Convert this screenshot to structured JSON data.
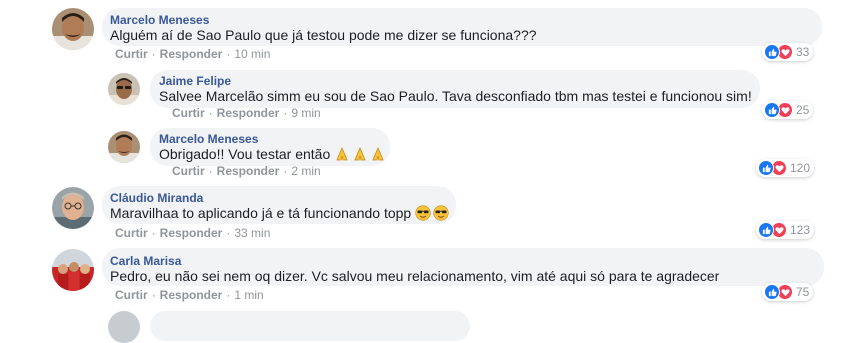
{
  "comments": [
    {
      "author": "Marcelo Meneses",
      "text": "Alguém aí de Sao Paulo que já testou pode me dizer se funciona???",
      "like_label": "Curtir",
      "reply_label": "Responder",
      "time": "10 min",
      "reaction_count": "33",
      "avatar_icon": "man-avatar-icon"
    },
    {
      "author": "Jaime Felipe",
      "text": "Salvee Marcelão simm eu sou de Sao Paulo. Tava desconfiado tbm mas testei e funcionou sim!",
      "like_label": "Curtir",
      "reply_label": "Responder",
      "time": "9 min",
      "reaction_count": "25",
      "avatar_icon": "man-sunglasses-avatar-icon"
    },
    {
      "author": "Marcelo Meneses",
      "text": "Obrigado!! Vou testar então",
      "emojis": [
        "folded-hands-emoji",
        "folded-hands-emoji",
        "folded-hands-emoji"
      ],
      "like_label": "Curtir",
      "reply_label": "Responder",
      "time": "2 min",
      "reaction_count": "120",
      "avatar_icon": "man-avatar-icon"
    },
    {
      "author": "Cláudio Miranda",
      "text": "Maravilhaa to aplicando já e tá funcionando topp",
      "emojis": [
        "sunglasses-face-emoji",
        "sunglasses-face-emoji"
      ],
      "like_label": "Curtir",
      "reply_label": "Responder",
      "time": "33 min",
      "reaction_count": "123",
      "avatar_icon": "man-glasses-avatar-icon"
    },
    {
      "author": "Carla Marisa",
      "text": "Pedro, eu não sei nem oq dizer. Vc salvou meu relacionamento, vim até aqui só para te agradecer",
      "like_label": "Curtir",
      "reply_label": "Responder",
      "time": "1 min",
      "reaction_count": "75",
      "avatar_icon": "group-photo-avatar-icon"
    }
  ],
  "colors": {
    "name": "#385898",
    "bubble": "#f2f3f5",
    "meta": "#90949c",
    "like": "#1877f2",
    "love": "#f33e58"
  }
}
